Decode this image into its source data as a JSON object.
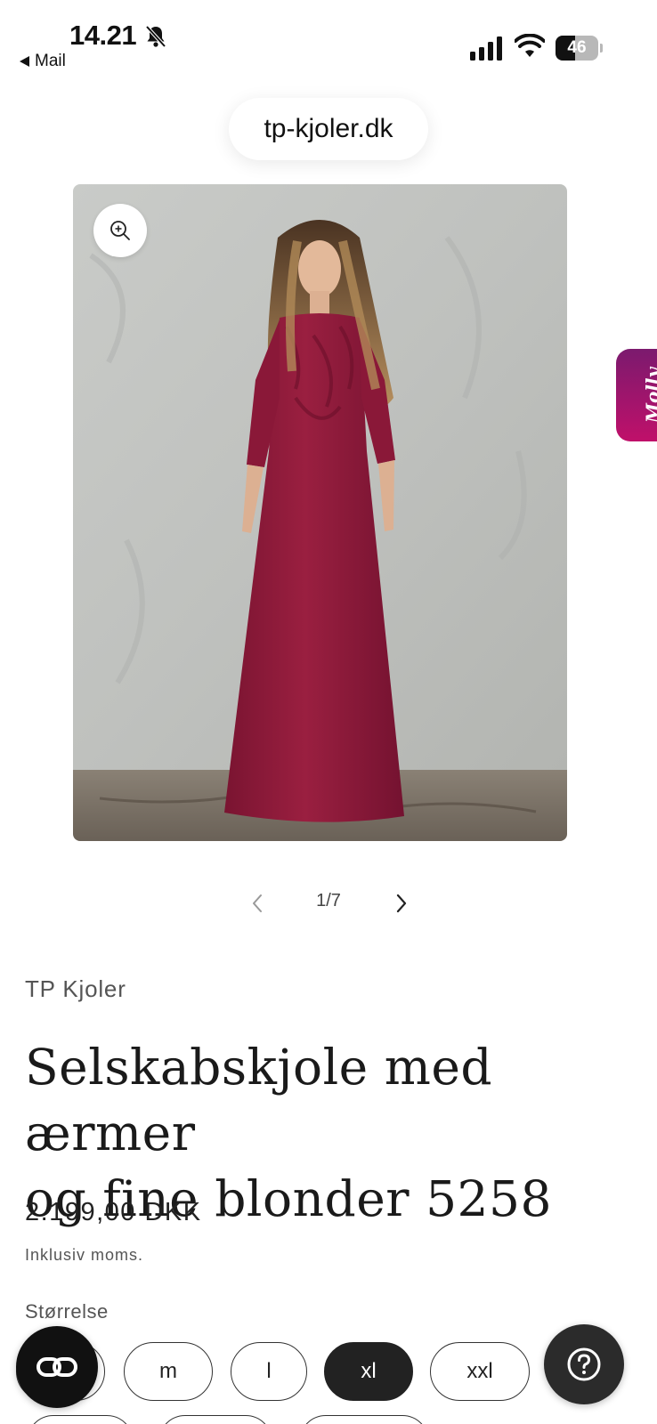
{
  "status_bar": {
    "time": "14.21",
    "back_label": "Mail",
    "battery_level": "46",
    "battery_fraction": 0.46,
    "icons": [
      "bell-slash-icon",
      "cellular-signal-icon",
      "wifi-icon",
      "battery-icon"
    ]
  },
  "browser": {
    "url": "tp-kjoler.dk"
  },
  "gallery": {
    "counter": "1/7",
    "dress_color": "#8e1a3a",
    "icons": [
      "zoom-in-icon",
      "chevron-left-icon",
      "chevron-right-icon"
    ]
  },
  "side_tab": {
    "label": "Molly"
  },
  "product": {
    "vendor": "TP Kjoler",
    "title_line1": "Selskabskjole med ærmer",
    "title_line2": "og fine blonder 5258",
    "price": "2.199,00 DKK",
    "tax_note": "Inklusiv moms.",
    "size_label": "Størrelse",
    "sizes": [
      {
        "label": "s",
        "selected": false
      },
      {
        "label": "m",
        "selected": false
      },
      {
        "label": "l",
        "selected": false
      },
      {
        "label": "xl",
        "selected": true
      },
      {
        "label": "xxl",
        "selected": false
      }
    ]
  },
  "floating": {
    "chat_icon": "chain-link-icon",
    "help_icon": "question-mark-icon"
  }
}
